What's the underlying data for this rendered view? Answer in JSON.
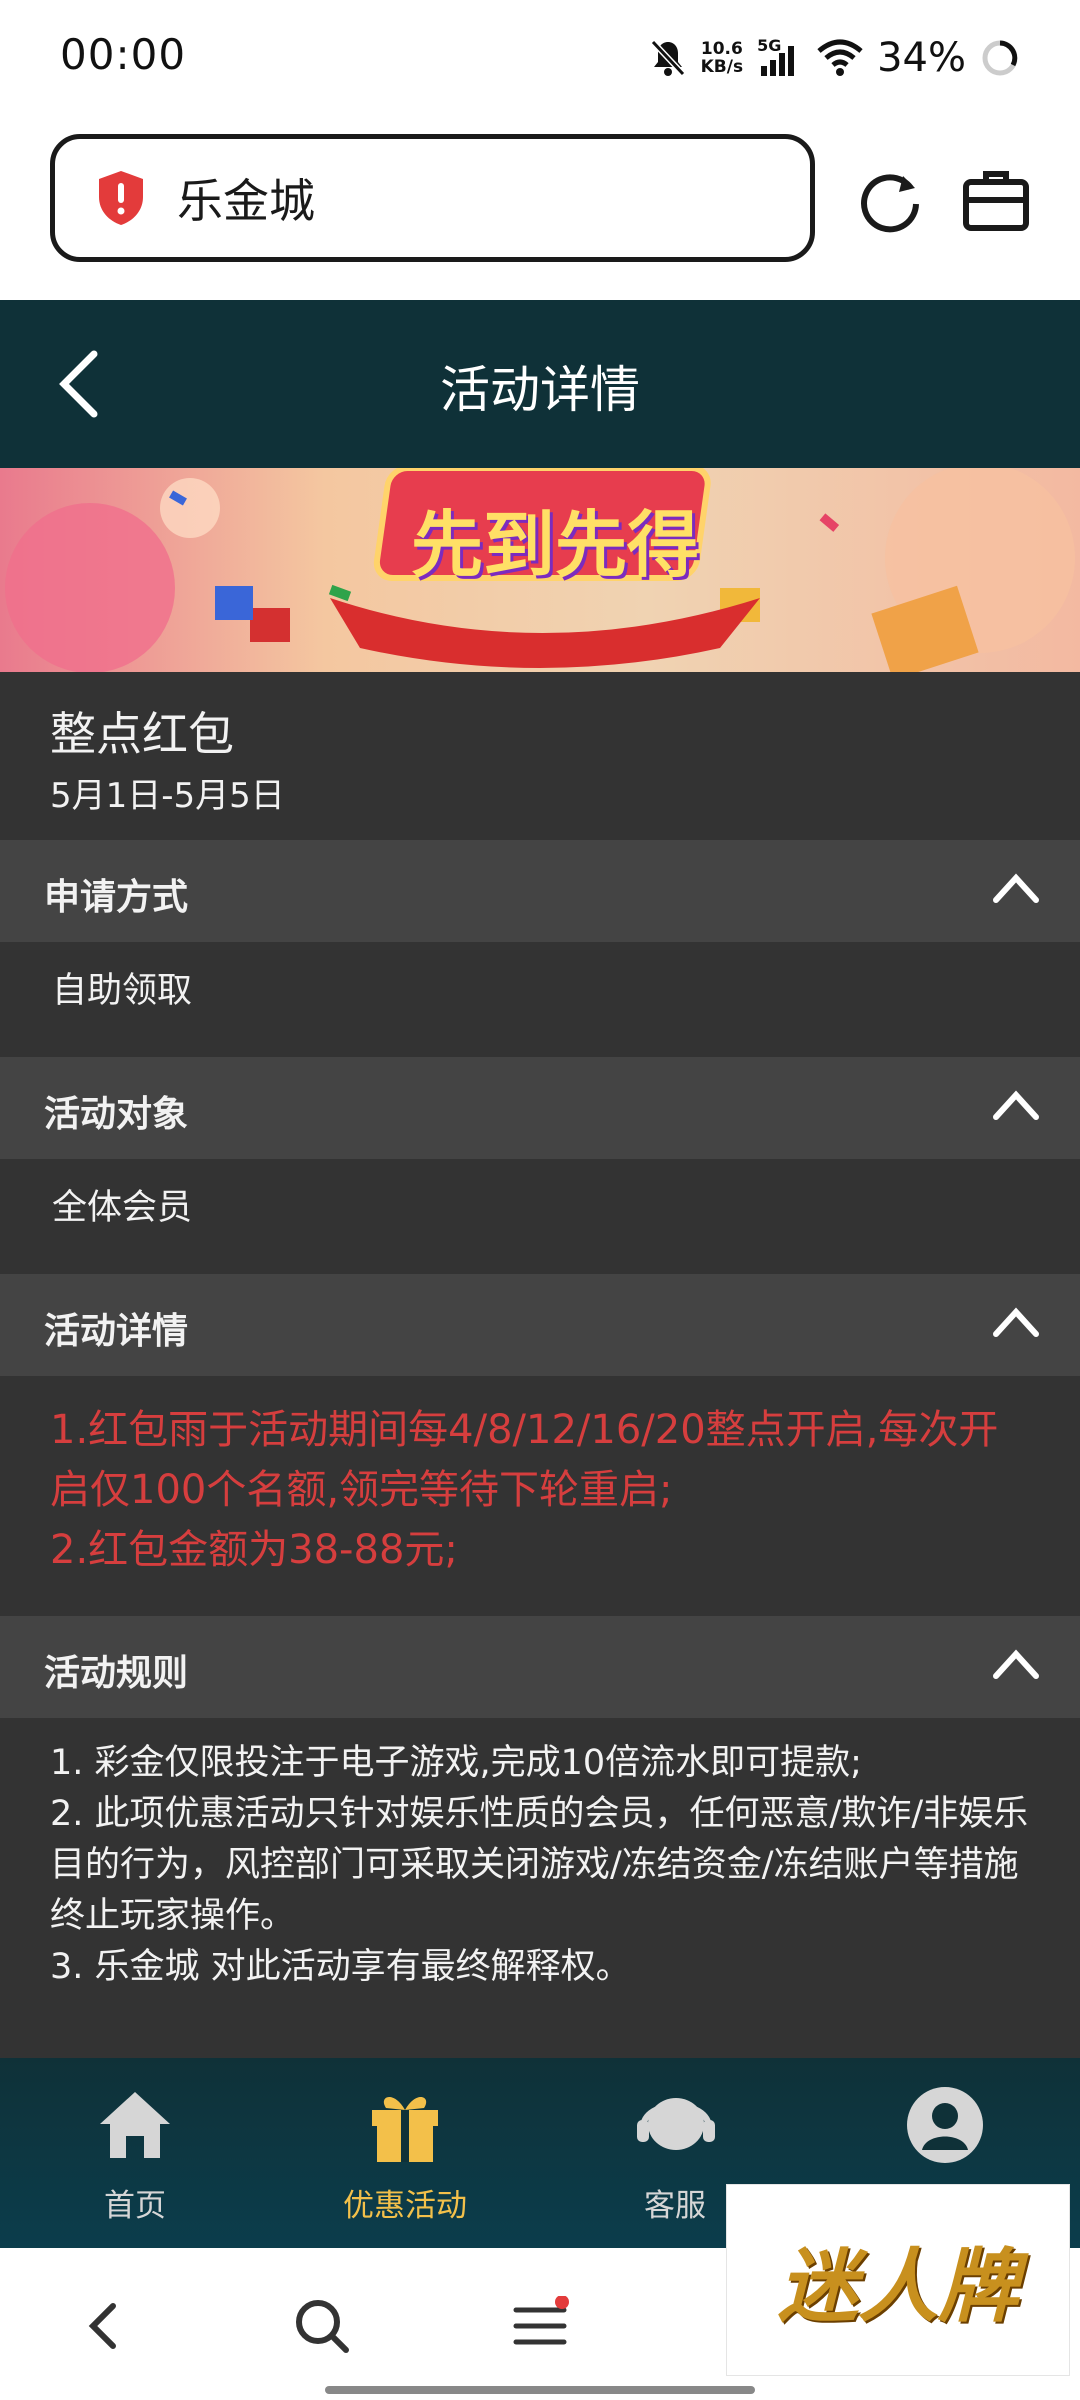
{
  "status_bar": {
    "time": "00:00",
    "net_speed_value": "10.6",
    "net_speed_unit": "KB/s",
    "network": "5G",
    "battery": "34%",
    "icons": [
      "mute-bell-icon",
      "signal-icon",
      "wifi-icon",
      "battery-ring-icon"
    ]
  },
  "browser": {
    "address_text": "乐金城",
    "icons": [
      "shield-warning-icon",
      "reload-icon",
      "briefcase-icon"
    ]
  },
  "header": {
    "title": "活动详情",
    "back_icon": "chevron-left-icon"
  },
  "banner": {
    "text": "先到先得"
  },
  "promotion": {
    "title": "整点红包",
    "date": "5月1日-5月5日"
  },
  "sections": [
    {
      "label": "申请方式",
      "body": "自助领取"
    },
    {
      "label": "活动对象",
      "body": "全体会员"
    },
    {
      "label": "活动详情",
      "body_lines": [
        "1.红包雨于活动期间每4/8/12/16/20整点开启,每次开启仅100个名额,领完等待下轮重启;",
        "2.红包金额为38-88元;"
      ]
    },
    {
      "label": "活动规则",
      "body_lines": [
        "1. 彩金仅限投注于电子游戏,完成10倍流水即可提款;",
        "2. 此项优惠活动只针对娱乐性质的会员，任何恶意/欺诈/非娱乐目的行为，风控部门可采取关闭游戏/冻结资金/冻结账户等措施终止玩家操作。",
        "3. 乐金城 对此活动享有最终解释权。"
      ]
    }
  ],
  "tabbar": {
    "items": [
      {
        "label": "首页",
        "icon": "home-icon"
      },
      {
        "label": "优惠活动",
        "icon": "gift-icon",
        "active": true
      },
      {
        "label": "客服",
        "icon": "headset-icon"
      },
      {
        "label": "",
        "icon": "user-icon"
      }
    ],
    "active_color": "#f3c04a"
  },
  "system_nav": {
    "icons": [
      "back-icon",
      "search-icon",
      "menu-icon"
    ]
  },
  "watermark": {
    "text": "迷人牌"
  },
  "colors": {
    "header_bg": "#0f3138",
    "section_head_bg": "#444444",
    "section_body_bg": "#333333",
    "highlight_text": "#d63e3e"
  }
}
